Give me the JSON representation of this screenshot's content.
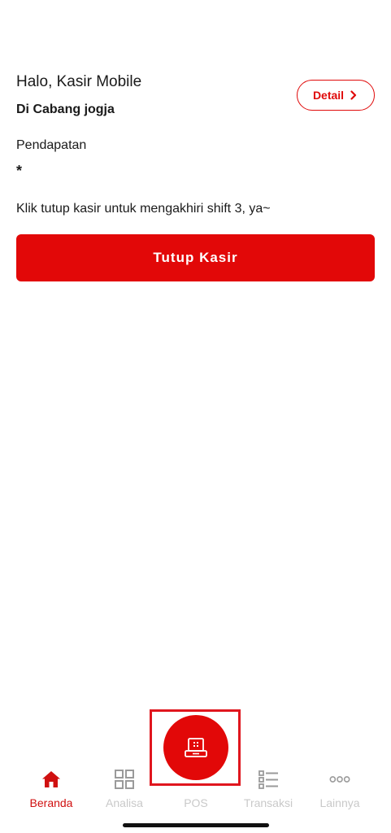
{
  "header": {
    "greeting": "Halo, Kasir Mobile",
    "branch": "Di Cabang jogja",
    "detail_label": "Detail"
  },
  "revenue": {
    "label": "Pendapatan",
    "value": "*"
  },
  "shift": {
    "message": "Klik tutup kasir untuk mengakhiri shift 3, ya~",
    "close_label": "Tutup Kasir"
  },
  "nav": {
    "items": [
      {
        "label": "Beranda",
        "icon": "home-icon",
        "active": true
      },
      {
        "label": "Analisa",
        "icon": "grid-icon",
        "active": false
      },
      {
        "label": "POS",
        "icon": "cash-register-icon",
        "active": false
      },
      {
        "label": "Transaksi",
        "icon": "list-icon",
        "active": false
      },
      {
        "label": "Lainnya",
        "icon": "more-icon",
        "active": false
      }
    ]
  },
  "colors": {
    "primary": "#e20808",
    "inactive": "#c9c9c9"
  }
}
